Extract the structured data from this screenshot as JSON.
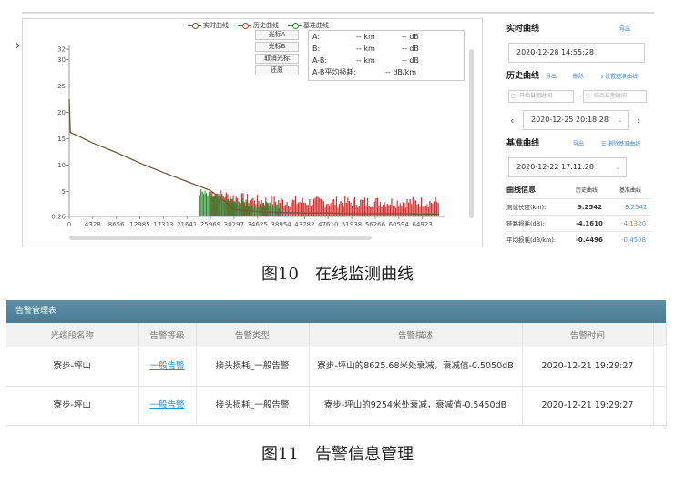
{
  "fig10": {
    "caption": "图10　在线监测曲线",
    "legend": [
      {
        "label": "实时曲线",
        "color": "#6b5a3a"
      },
      {
        "label": "历史曲线",
        "color": "#d83030"
      },
      {
        "label": "基准曲线",
        "color": "#2f8a2f"
      }
    ],
    "cursor_buttons": [
      "光标A",
      "光标B",
      "取消光标",
      "还原"
    ],
    "measurements": [
      {
        "label": "A:",
        "km": "-- km",
        "db": "-- dB"
      },
      {
        "label": "B:",
        "km": "-- km",
        "db": "-- dB"
      },
      {
        "label": "A-B:",
        "km": "-- km",
        "db": "-- dB"
      }
    ],
    "avg_loss_label": "A-B平均损耗:",
    "avg_loss_value": "-- dB/km",
    "right_panel": {
      "realtime_title": "实时曲线",
      "export_label": "导出",
      "realtime_time": "2020-12-28 14:55:28",
      "history_title": "历史曲线",
      "history_export": "导出",
      "history_delete": "删除",
      "history_set_baseline": "设置基准曲线",
      "start_placeholder": "开始日期时间",
      "end_placeholder": "结束日期时间",
      "history_time": "2020-12-25 20:18:28",
      "baseline_title": "基准曲线",
      "baseline_export": "导出",
      "baseline_delete": "删除基准曲线",
      "baseline_time": "2020-12-22 17:11:28",
      "info_title": "曲线信息",
      "col_history": "历史曲线",
      "col_baseline": "基准曲线",
      "rows": [
        {
          "label": "测试长度(km):",
          "history": "9.2542",
          "baseline": "9.2542"
        },
        {
          "label": "链路损耗(dB):",
          "history": "-4.1610",
          "baseline": "-4.1320"
        },
        {
          "label": "平均损耗(dB/km):",
          "history": "-0.4496",
          "baseline": "-0.4508"
        }
      ]
    }
  },
  "chart_data": {
    "type": "line",
    "x_tick_labels": [
      "0",
      "4328",
      "8656",
      "12985",
      "17313",
      "21641",
      "25969",
      "30297",
      "34625",
      "38954",
      "43282",
      "47610",
      "51938",
      "56266",
      "60594",
      "64923"
    ],
    "y_tick_labels": [
      "0.26",
      "5",
      "10",
      "15",
      "20",
      "25",
      "30",
      "32"
    ],
    "xlim": [
      0,
      69000
    ],
    "ylim": [
      0.26,
      32
    ],
    "series": [
      {
        "name": "实时曲线",
        "color": "#6b5a3a",
        "x": [
          0,
          200,
          1500,
          4328,
          8656,
          12985,
          17313,
          21641,
          25969,
          28000,
          30297,
          34625,
          38954,
          43282,
          47610,
          51938,
          56266,
          60594,
          64923,
          68000
        ],
        "y": [
          22.5,
          16.2,
          15.6,
          14.2,
          12.4,
          10.4,
          8.6,
          6.9,
          5.2,
          3.6,
          1.6,
          1.2,
          1.0,
          0.9,
          0.9,
          0.8,
          0.8,
          0.8,
          0.7,
          0.7
        ]
      },
      {
        "name": "历史曲线",
        "color": "#d83030",
        "x": [
          26000,
          30297,
          34625,
          38954,
          43282,
          47610,
          51938,
          56266,
          60594,
          64923,
          68000
        ],
        "y": [
          3.2,
          2.2,
          1.6,
          1.4,
          1.3,
          1.3,
          1.3,
          1.3,
          1.3,
          1.3,
          1.3
        ]
      },
      {
        "name": "基准曲线",
        "color": "#2f8a2f",
        "x": [
          24000,
          26000,
          30297,
          34625,
          38954
        ],
        "y": [
          3.6,
          2.8,
          1.8,
          1.2,
          1.0
        ]
      }
    ]
  },
  "fig11": {
    "caption": "图11　告警信息管理",
    "header_title": "告警管理表",
    "columns": [
      "光缆段名称",
      "告警等级",
      "告警类型",
      "告警描述",
      "告警时间"
    ],
    "rows": [
      {
        "name": "寮步-坪山",
        "level": "一般告警",
        "type": "接头损耗_一般告警",
        "desc": "寮步-坪山的8625.68米处衰减，衰减值-0.5050dB",
        "time": "2020-12-21 19:29:27"
      },
      {
        "name": "寮步-坪山",
        "level": "一般告警",
        "type": "接头损耗_一般告警",
        "desc": "寮步-坪山的9254米处衰减，衰减值-0.5450dB",
        "time": "2020-12-21 19:29:27"
      }
    ]
  }
}
